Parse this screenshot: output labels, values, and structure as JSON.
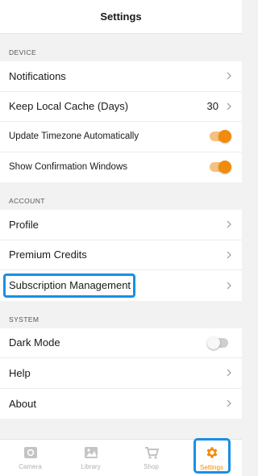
{
  "header": {
    "title": "Settings"
  },
  "sections": {
    "device": {
      "title": "DEVICE",
      "notifications": "Notifications",
      "cache_label": "Keep Local Cache (Days)",
      "cache_value": "30",
      "timezone_label": "Update Timezone Automatically",
      "timezone_enabled": true,
      "confirm_label": "Show Confirmation Windows",
      "confirm_enabled": true
    },
    "account": {
      "title": "ACCOUNT",
      "profile": "Profile",
      "credits": "Premium Credits",
      "subscription": "Subscription Management"
    },
    "system": {
      "title": "SYSTEM",
      "dark_mode_label": "Dark Mode",
      "dark_mode_enabled": false,
      "help": "Help",
      "about": "About"
    }
  },
  "tabbar": {
    "tabs": [
      {
        "label": "Camera",
        "icon": "camera-icon",
        "active": false
      },
      {
        "label": "Library",
        "icon": "image-icon",
        "active": false
      },
      {
        "label": "Shop",
        "icon": "cart-icon",
        "active": false
      },
      {
        "label": "Settings",
        "icon": "gear-icon",
        "active": true
      }
    ]
  },
  "colors": {
    "accent": "#f28a0c",
    "highlight": "#1a8fe3",
    "inactive": "#b0b0b0"
  }
}
